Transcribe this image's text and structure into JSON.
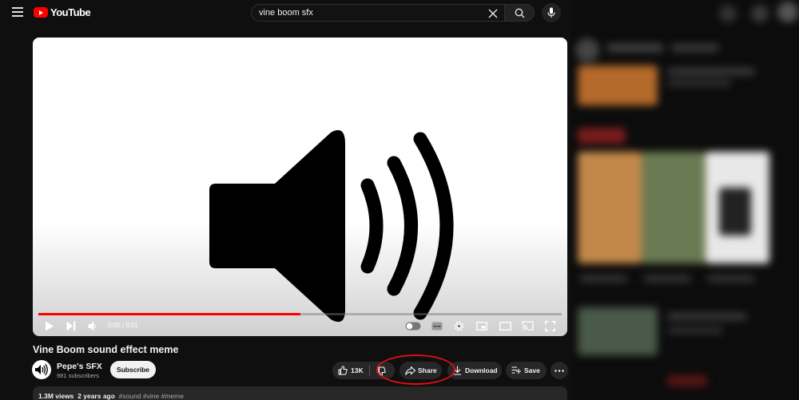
{
  "header": {
    "logo_text": "YouTube",
    "search_value": "vine boom sfx"
  },
  "player": {
    "time": "0:00 / 0:01",
    "progress": 0.5
  },
  "video": {
    "title": "Vine Boom sound effect meme",
    "channel_name": "Pepe's SFX",
    "subscribers": "981 subscribers",
    "subscribe_label": "Subscribe",
    "like_count": "13K",
    "share_label": "Share",
    "download_label": "Download",
    "save_label": "Save",
    "views": "1.3M views",
    "age": "2 years ago",
    "tags": "#sound #vine #meme"
  },
  "colors": {
    "brand_red": "#ff0000",
    "annotation_red": "#e10d17",
    "background": "#0f0f0f"
  }
}
